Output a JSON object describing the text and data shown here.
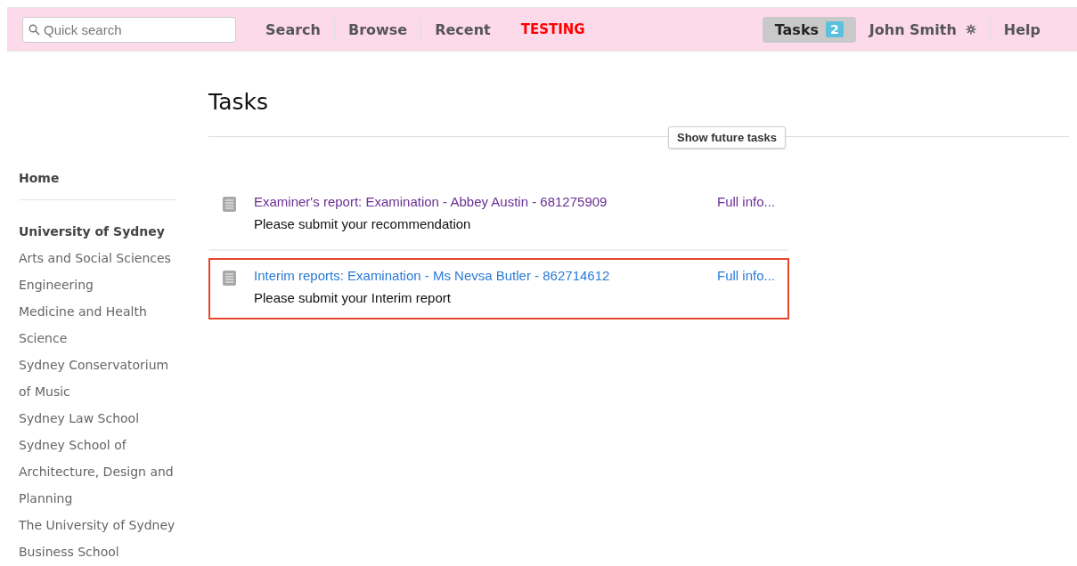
{
  "topbar": {
    "search": {
      "placeholder": "Quick search"
    },
    "nav": [
      {
        "label": "Search",
        "kind": "link"
      },
      {
        "label": "Browse",
        "kind": "link"
      },
      {
        "label": "Recent",
        "kind": "link"
      },
      {
        "label": "TESTING",
        "kind": "alert"
      }
    ],
    "tasks": {
      "label": "Tasks",
      "count": "2",
      "selected": true
    },
    "user": {
      "label": "John Smith"
    },
    "help": {
      "label": "Help"
    }
  },
  "sidebar": {
    "home": "Home",
    "heading": "University of Sydney",
    "items": [
      "Arts and Social Sciences",
      "Engineering",
      "Medicine and Health Science",
      "Sydney Conservatorium of Music",
      "Sydney Law School",
      "Sydney School of Architecture, Design and Planning",
      "The University of Sydney Business School"
    ]
  },
  "main": {
    "title": "Tasks",
    "future_button": "Show future tasks",
    "tasks": [
      {
        "title": "Examiner's report: Examination - Abbey Austin - 681275909",
        "more": "Full info...",
        "note": "Please submit your recommendation",
        "visited": true,
        "highlighted": false
      },
      {
        "title": "Interim reports: Examination - Ms Nevsa Butler - 862714612",
        "more": "Full info...",
        "note": "Please submit your Interim report",
        "visited": false,
        "highlighted": true
      }
    ]
  }
}
